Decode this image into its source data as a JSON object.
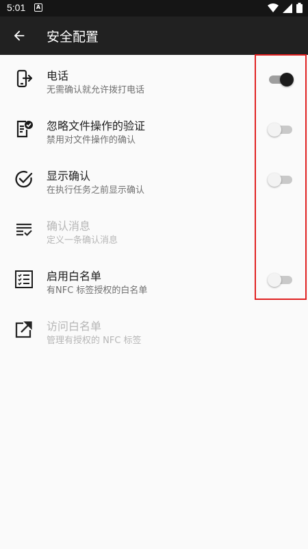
{
  "status_bar": {
    "time": "5:01",
    "notification_icon": "a-notification-icon",
    "wifi_icon": "wifi-icon",
    "signal_icon": "signal-icon",
    "battery_icon": "battery-icon"
  },
  "app_bar": {
    "back_icon": "arrow-back-icon",
    "title": "安全配置"
  },
  "settings": [
    {
      "icon": "phone-forward-icon",
      "title": "电话",
      "subtitle": "无需确认就允许拨打电话",
      "enabled": true,
      "has_switch": true,
      "switch_on": true
    },
    {
      "icon": "document-check-icon",
      "title": "忽略文件操作的验证",
      "subtitle": "禁用对文件操作的确认",
      "enabled": true,
      "has_switch": true,
      "switch_on": false
    },
    {
      "icon": "check-circle-icon",
      "title": "显示确认",
      "subtitle": "在执行任务之前显示确认",
      "enabled": true,
      "has_switch": true,
      "switch_on": false
    },
    {
      "icon": "list-check-icon",
      "title": "确认消息",
      "subtitle": "定义一条确认消息",
      "enabled": false,
      "has_switch": false
    },
    {
      "icon": "checklist-box-icon",
      "title": "启用白名单",
      "subtitle": "有NFC 标签授权的白名单",
      "enabled": true,
      "has_switch": true,
      "switch_on": false
    },
    {
      "icon": "open-external-icon",
      "title": "访问白名单",
      "subtitle": "管理有授权的 NFC 标签",
      "enabled": false,
      "has_switch": false
    }
  ],
  "colors": {
    "app_bar": "#212121",
    "status_bar": "#151515",
    "background": "#fafafa",
    "highlight": "#e02020"
  }
}
